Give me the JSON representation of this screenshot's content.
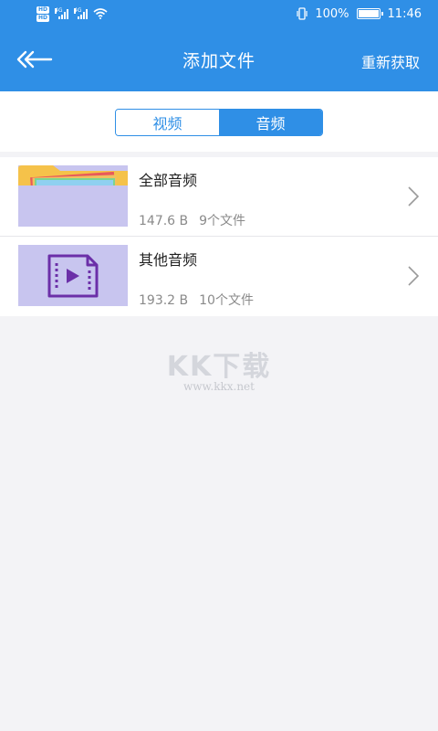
{
  "status_bar": {
    "hd_badge": "HD",
    "network_1": "4G",
    "network_2": "4G",
    "battery_percent": "100%",
    "time": "11:46"
  },
  "app_bar": {
    "title": "添加文件",
    "refetch_label": "重新获取"
  },
  "tabs": [
    {
      "label": "视频",
      "active": false
    },
    {
      "label": "音频",
      "active": true
    }
  ],
  "items": [
    {
      "title": "全部音频",
      "size": "147.6 B",
      "count": "9个文件",
      "icon": "folder-icon"
    },
    {
      "title": "其他音频",
      "size": "193.2 B",
      "count": "10个文件",
      "icon": "video-file-icon"
    }
  ],
  "watermark": {
    "logo": "KK下载",
    "url": "www.kkx.net"
  },
  "colors": {
    "primary": "#2f8fe6",
    "thumb_bg": "#c8c5ef",
    "icon_purple": "#6b2fa8"
  }
}
